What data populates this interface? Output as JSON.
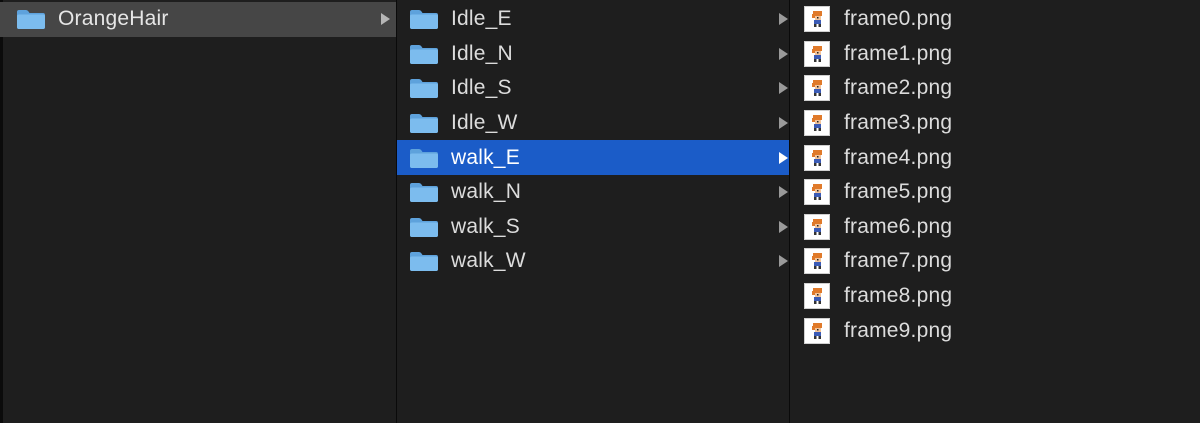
{
  "column1": {
    "items": [
      {
        "label": "OrangeHair",
        "icon": "folder-icon",
        "selected": true
      }
    ]
  },
  "column2": {
    "items": [
      {
        "label": "Idle_E",
        "icon": "folder-icon"
      },
      {
        "label": "Idle_N",
        "icon": "folder-icon"
      },
      {
        "label": "Idle_S",
        "icon": "folder-icon"
      },
      {
        "label": "Idle_W",
        "icon": "folder-icon"
      },
      {
        "label": "walk_E",
        "icon": "folder-icon",
        "selected": true
      },
      {
        "label": "walk_N",
        "icon": "folder-icon"
      },
      {
        "label": "walk_S",
        "icon": "folder-icon"
      },
      {
        "label": "walk_W",
        "icon": "folder-icon"
      }
    ]
  },
  "column3": {
    "items": [
      {
        "label": "frame0.png",
        "icon": "png-thumbnail-icon"
      },
      {
        "label": "frame1.png",
        "icon": "png-thumbnail-icon"
      },
      {
        "label": "frame2.png",
        "icon": "png-thumbnail-icon"
      },
      {
        "label": "frame3.png",
        "icon": "png-thumbnail-icon"
      },
      {
        "label": "frame4.png",
        "icon": "png-thumbnail-icon"
      },
      {
        "label": "frame5.png",
        "icon": "png-thumbnail-icon"
      },
      {
        "label": "frame6.png",
        "icon": "png-thumbnail-icon"
      },
      {
        "label": "frame7.png",
        "icon": "png-thumbnail-icon"
      },
      {
        "label": "frame8.png",
        "icon": "png-thumbnail-icon"
      },
      {
        "label": "frame9.png",
        "icon": "png-thumbnail-icon"
      }
    ]
  },
  "colors": {
    "background": "#1e1e1e",
    "text": "#dcdcdc",
    "selection_active": "#1b5cc8",
    "selection_inactive": "#464646",
    "folder_blue": "#6fb0e6",
    "hair_orange": "#e07a2a"
  }
}
